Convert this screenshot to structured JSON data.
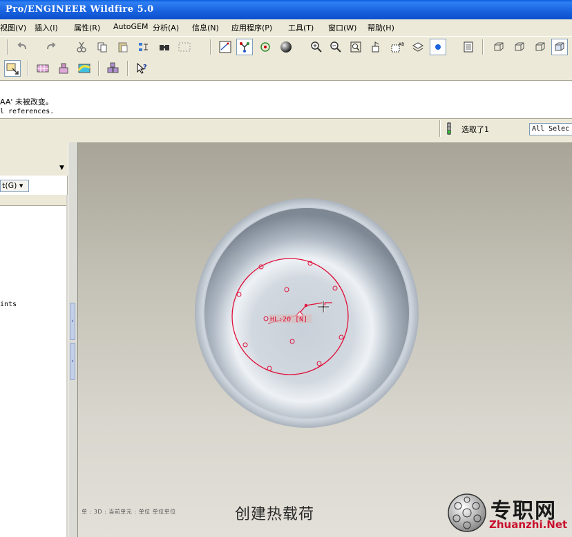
{
  "window": {
    "title": "Pro/ENGINEER Wildfire 5.0"
  },
  "menu": [
    "视图(V)",
    "插入(I)",
    "属性(R)",
    "AutoGEM",
    "分析(A)",
    "信息(N)",
    "应用程序(P)",
    "工具(T)",
    "窗口(W)",
    "帮助(H)"
  ],
  "toolbar1": {
    "icons": [
      "undo-icon",
      "redo-icon",
      "cut-icon",
      "copy-icon",
      "paste-icon",
      "paste-special-icon",
      "regenerate-icon",
      "find-icon",
      "select-box-icon",
      "sketch-icon",
      "datum-display-icon",
      "spin-center-icon",
      "shading-icon",
      "zoom-in-icon",
      "zoom-out-icon",
      "refit-icon",
      "orient-icon",
      "saved-views-icon",
      "layers-icon",
      "display-style-icon",
      "model-tree-icon",
      "wireframe-icon",
      "hidden-line-icon",
      "no-hidden-icon",
      "shaded-icon"
    ]
  },
  "toolbar2": {
    "icons": [
      "mesh-icon",
      "load-icon",
      "constraint-icon",
      "analysis-icon",
      "results-icon",
      "whats-this-icon"
    ]
  },
  "messages": {
    "line1": "AA' 未被改变。",
    "line2": "l references."
  },
  "status": {
    "selected": "选取了1",
    "filter": "All Selec"
  },
  "nav": {
    "filter_label": "t(G)",
    "tree_item": "ints"
  },
  "model": {
    "annotation": "HL:20 [N]"
  },
  "bottom_status": "单 : 3D : 当前单元 : 单位 单位单位",
  "subtitle": "创建热载荷",
  "logo": {
    "cn": "专职网",
    "en": "Zhuanzhi.Net"
  },
  "colors": {
    "title_bar": "#1a64e0",
    "constraint_red": "#e0103a",
    "logo_red": "#c8102e"
  }
}
